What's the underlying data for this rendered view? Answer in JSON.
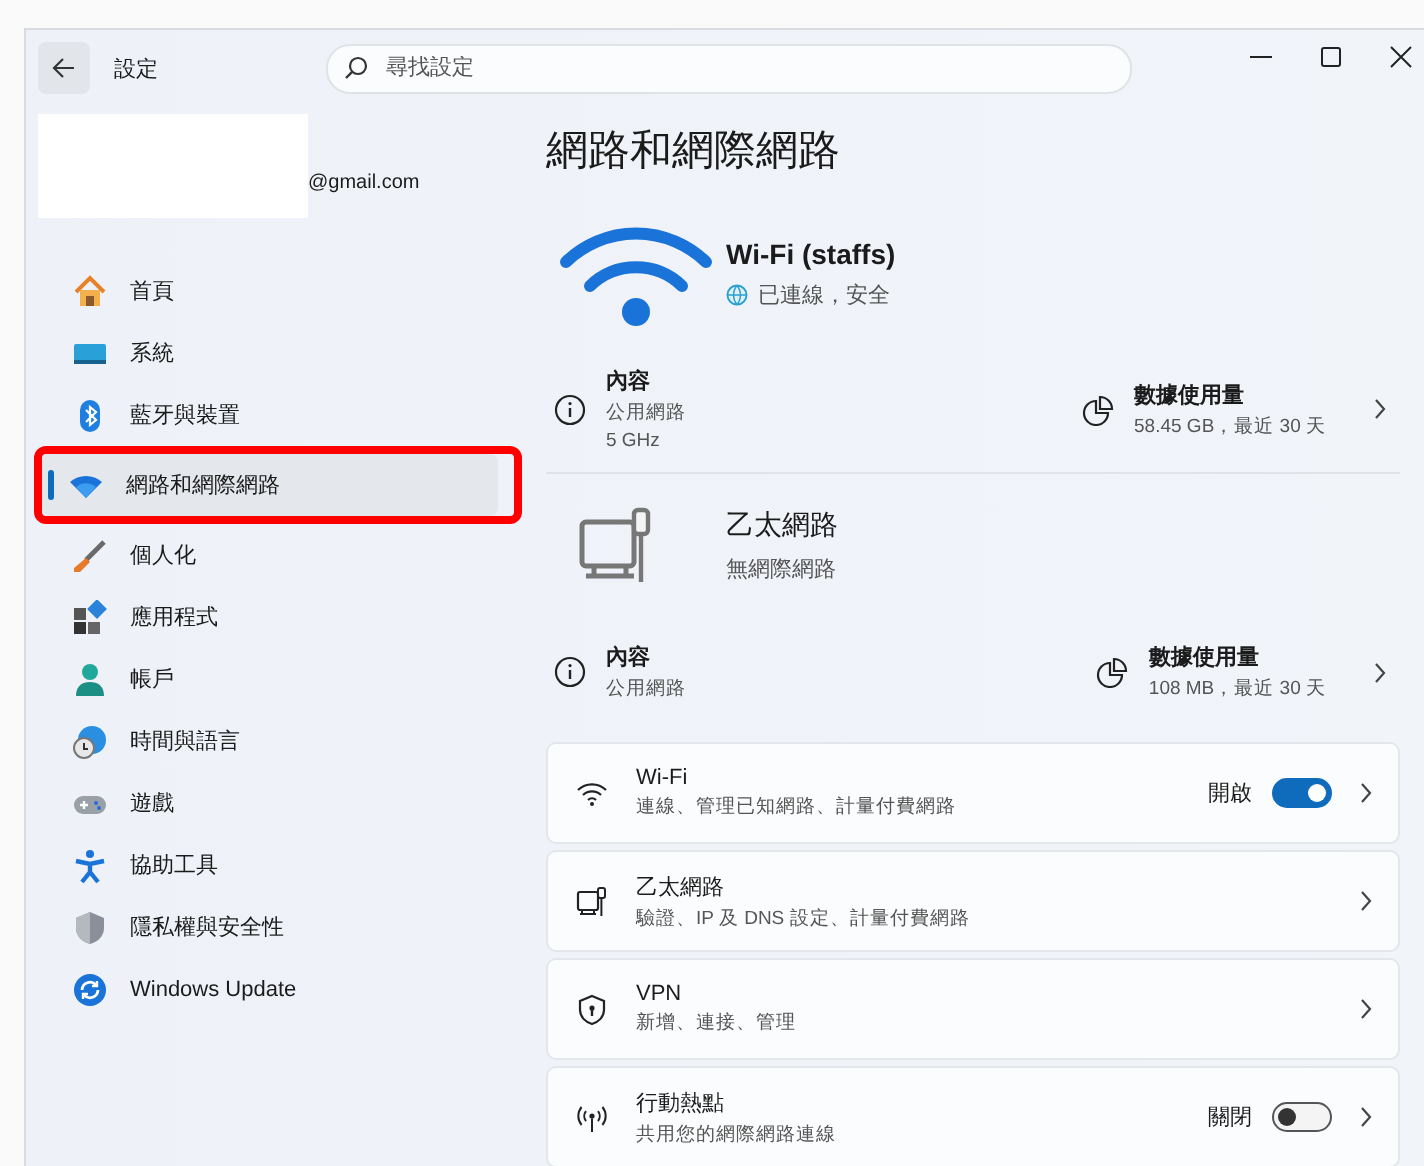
{
  "window": {
    "title": "設定",
    "search": {
      "placeholder": "尋找設定"
    }
  },
  "account": {
    "email": "@gmail.com"
  },
  "sidebar": {
    "items": [
      {
        "label": "首頁",
        "selected": false,
        "annotated": false
      },
      {
        "label": "系統",
        "selected": false,
        "annotated": false
      },
      {
        "label": "藍牙與裝置",
        "selected": false,
        "annotated": false
      },
      {
        "label": "網路和網際網路",
        "selected": true,
        "annotated": true
      },
      {
        "label": "個人化",
        "selected": false,
        "annotated": false
      },
      {
        "label": "應用程式",
        "selected": false,
        "annotated": false
      },
      {
        "label": "帳戶",
        "selected": false,
        "annotated": false
      },
      {
        "label": "時間與語言",
        "selected": false,
        "annotated": false
      },
      {
        "label": "遊戲",
        "selected": false,
        "annotated": false
      },
      {
        "label": "協助工具",
        "selected": false,
        "annotated": false
      },
      {
        "label": "隱私權與安全性",
        "selected": false,
        "annotated": false
      },
      {
        "label": "Windows Update",
        "selected": false,
        "annotated": false
      }
    ]
  },
  "page_title": "網路和網際網路",
  "connections": [
    {
      "kind": "wifi",
      "name": "Wi-Fi (staffs)",
      "status": "已連線，安全",
      "properties": {
        "label": "內容",
        "lines": [
          "公用網路",
          "5 GHz"
        ]
      },
      "data_usage": {
        "label": "數據使用量",
        "value": "58.45 GB，最近 30 天"
      }
    },
    {
      "kind": "ethernet",
      "name": "乙太網路",
      "status": "無網際網路",
      "properties": {
        "label": "內容",
        "lines": [
          "公用網路"
        ]
      },
      "data_usage": {
        "label": "數據使用量",
        "value": "108 MB，最近 30 天"
      }
    }
  ],
  "settings": [
    {
      "kind": "wifi",
      "title": "Wi-Fi",
      "subtitle": "連線、管理已知網路、計量付費網路",
      "toggle": {
        "label": "開啟",
        "on": true
      }
    },
    {
      "kind": "ethernet",
      "title": "乙太網路",
      "subtitle": "驗證、IP 及 DNS 設定、計量付費網路"
    },
    {
      "kind": "vpn",
      "title": "VPN",
      "subtitle": "新增、連接、管理"
    },
    {
      "kind": "hotspot",
      "title": "行動熱點",
      "subtitle": "共用您的網際網路連線",
      "toggle": {
        "label": "關閉",
        "on": false
      }
    }
  ]
}
